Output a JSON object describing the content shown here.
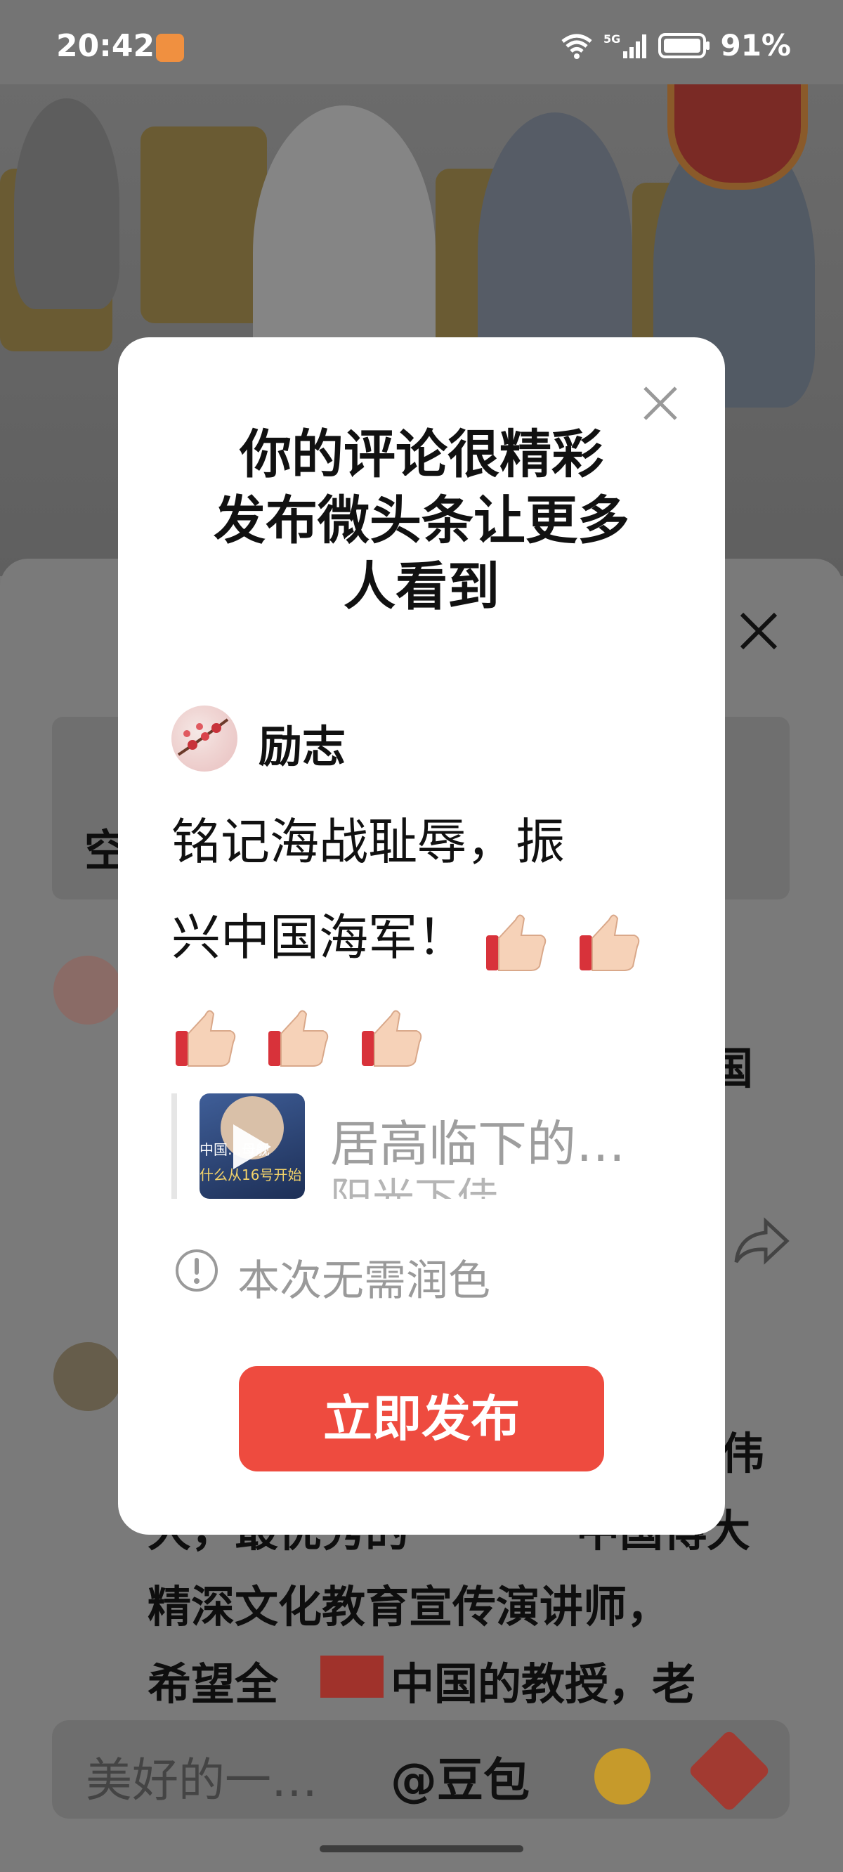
{
  "status_bar": {
    "time": "20:42",
    "network": "5G",
    "battery": "91%"
  },
  "background": {
    "sheet_lines": [
      "伟",
      "大，最优秀的",
      "中国博大",
      "精深文化教育宣传演讲师，",
      "希望全",
      "中国的教授，老"
    ],
    "topic_glyph": "空",
    "partial_char": "国"
  },
  "dialog": {
    "title_lines": [
      "你的评论很精彩",
      "发布微头条让更多",
      "人看到"
    ],
    "user_name": "励志",
    "post_line1": "铭记海战耻辱，振",
    "post_line2": "兴中国海军！",
    "video_caption": "居高临下的…",
    "video_caption_sub": "阳光下佳",
    "video_overlay": [
      "中国…母舰",
      "什么从16号开始"
    ],
    "notice": "本次无需润色",
    "publish_label": "立即发布"
  },
  "input_bar": {
    "placeholder": "美好的一…",
    "mention": "@豆包"
  },
  "colors": {
    "accent": "#ee4b3f",
    "dialog_bg": "#ffffff",
    "overlay": "#777777"
  }
}
